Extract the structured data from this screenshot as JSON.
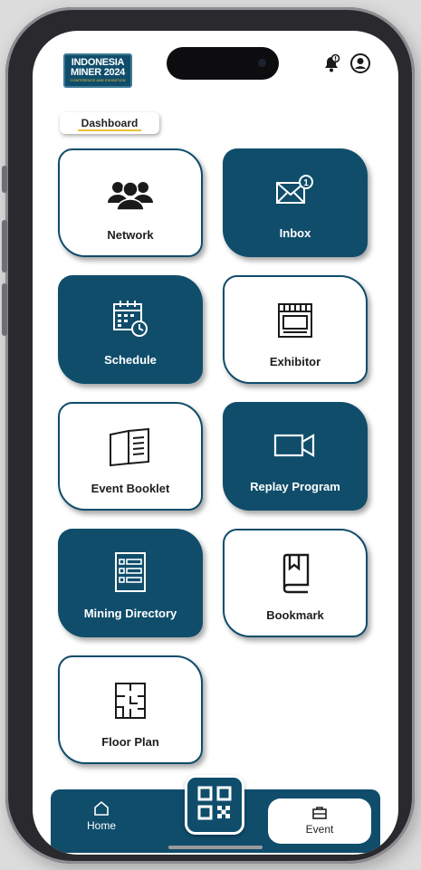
{
  "brand": {
    "line1": "INDONESIA",
    "line2": "MINER 2024",
    "line3": "CONFERENCE AND EXHIBITION"
  },
  "header": {
    "tab_label": "Dashboard"
  },
  "tiles": [
    {
      "label": "Network",
      "icon": "people-icon",
      "style": "light"
    },
    {
      "label": "Inbox",
      "icon": "mail-icon",
      "style": "dark",
      "badge": "1"
    },
    {
      "label": "Schedule",
      "icon": "calendar-icon",
      "style": "dark"
    },
    {
      "label": "Exhibitor",
      "icon": "booth-icon",
      "style": "light"
    },
    {
      "label": "Event Booklet",
      "icon": "book-icon",
      "style": "light"
    },
    {
      "label": "Replay Program",
      "icon": "video-camera-icon",
      "style": "dark"
    },
    {
      "label": "Mining Directory",
      "icon": "directory-icon",
      "style": "dark"
    },
    {
      "label": "Bookmark",
      "icon": "bookmark-icon",
      "style": "light"
    },
    {
      "label": "Floor Plan",
      "icon": "floor-plan-icon",
      "style": "light"
    }
  ],
  "bottom_nav": {
    "home_label": "Home",
    "event_label": "Event",
    "qr_icon": "qr-code-icon"
  },
  "colors": {
    "primary": "#0f4d6b",
    "accent": "#e8c23a",
    "background": "#ffffff"
  }
}
